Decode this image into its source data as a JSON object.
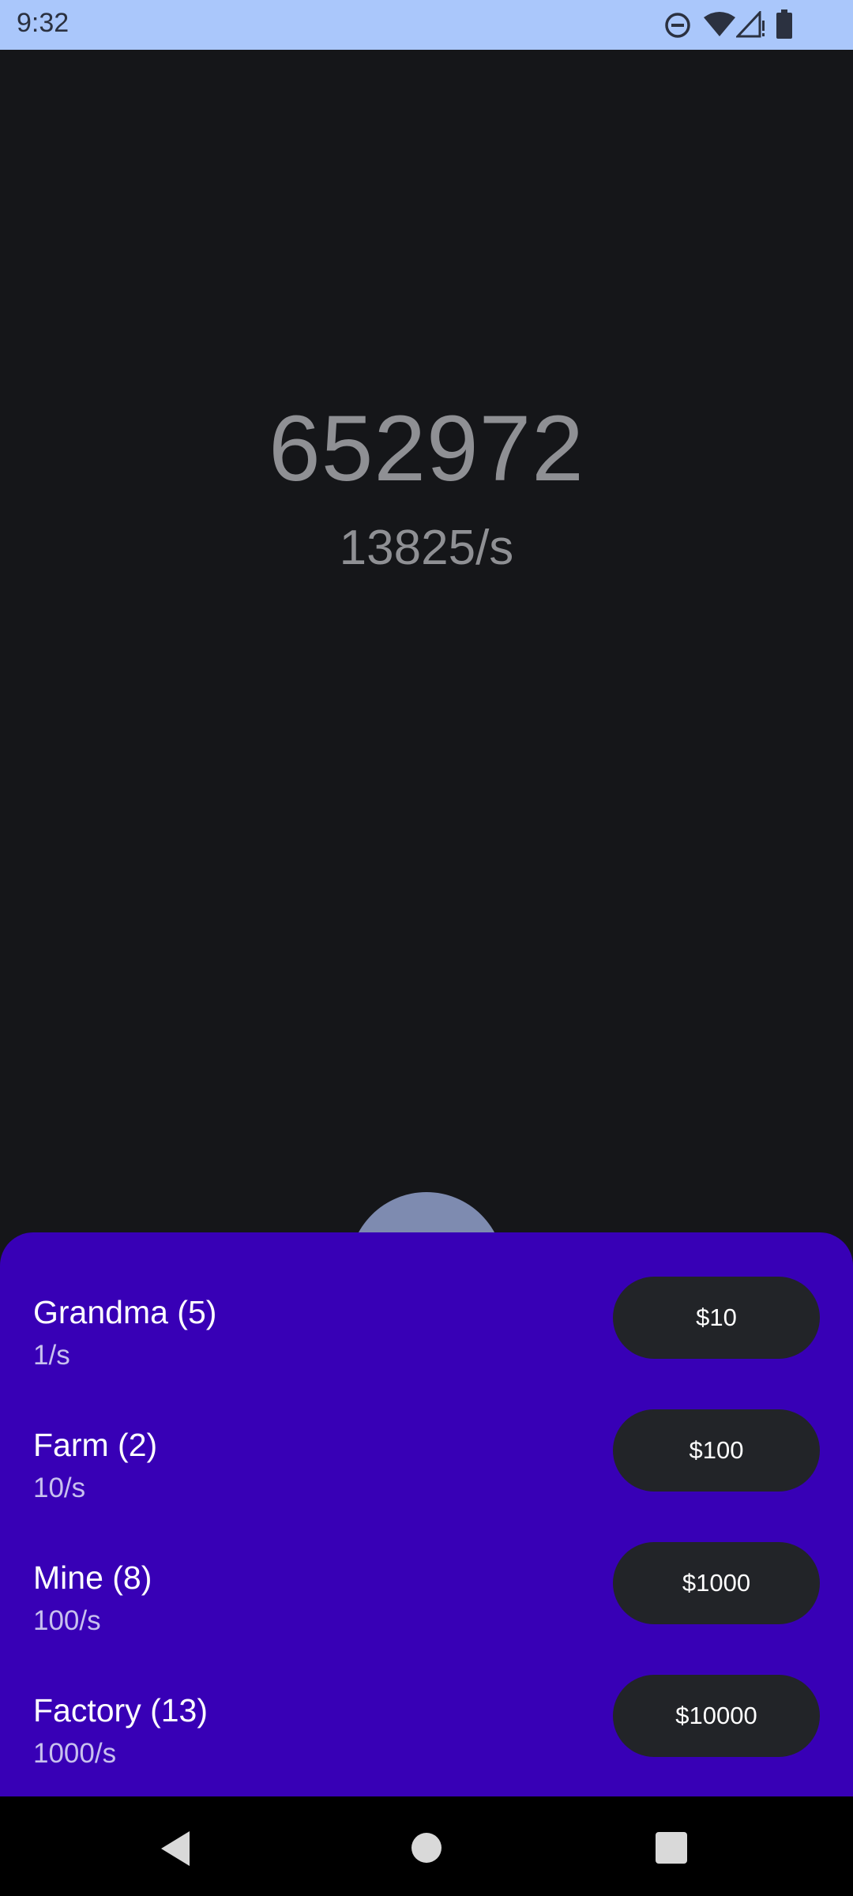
{
  "status_bar": {
    "time": "9:32",
    "icons": [
      "do-not-disturb-icon",
      "wifi-icon",
      "cellular-signal-icon",
      "battery-icon"
    ],
    "background": "#aac7fb"
  },
  "counter": {
    "value": "652972",
    "rate": "13825/s"
  },
  "shop": {
    "background": "#3800b6",
    "items": [
      {
        "name": "Grandma (5)",
        "rate": "1/s",
        "price": "$10"
      },
      {
        "name": "Farm (2)",
        "rate": "10/s",
        "price": "$100"
      },
      {
        "name": "Mine (8)",
        "rate": "100/s",
        "price": "$1000"
      },
      {
        "name": "Factory (13)",
        "rate": "1000/s",
        "price": "$10000"
      }
    ]
  },
  "nav_bar": {
    "icons": [
      "back-icon",
      "home-icon",
      "recents-icon"
    ]
  }
}
